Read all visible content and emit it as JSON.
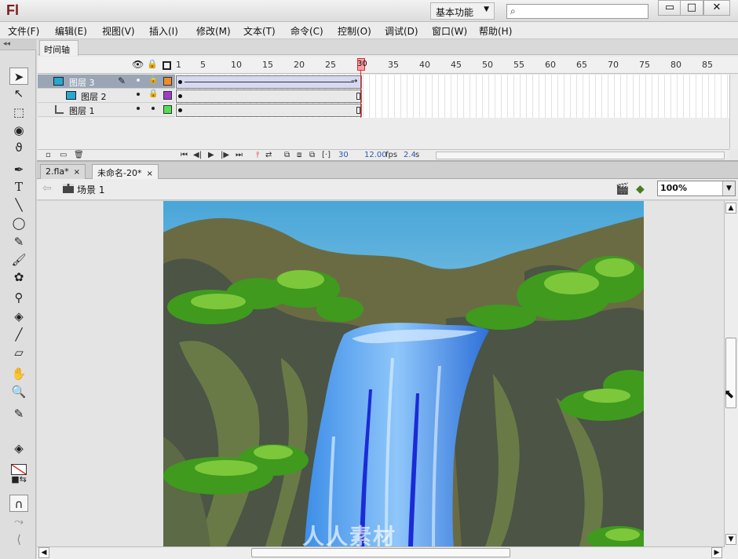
{
  "app": {
    "logo": "Fl",
    "workspace": "基本功能",
    "search_placeholder": "",
    "window_controls": {
      "minimize": "▭",
      "maximize": "□",
      "close": "✕"
    }
  },
  "menu": [
    "文件(F)",
    "编辑(E)",
    "视图(V)",
    "插入(I)",
    "修改(M)",
    "文本(T)",
    "命令(C)",
    "控制(O)",
    "调试(D)",
    "窗口(W)",
    "帮助(H)"
  ],
  "timeline": {
    "panel_title": "时间轴",
    "frame_numbers": [
      "1",
      "5",
      "10",
      "15",
      "20",
      "25",
      "30",
      "35",
      "40",
      "45",
      "50",
      "55",
      "60",
      "65",
      "70",
      "75",
      "80",
      "85"
    ],
    "current_frame": "30",
    "layers": [
      {
        "name": "图层 3",
        "color": "#f08c2a",
        "selected": true,
        "tween": true
      },
      {
        "name": "图层 2",
        "color": "#a03cc8",
        "selected": false,
        "tween": false
      },
      {
        "name": "图层 1",
        "color": "#50e050",
        "selected": false,
        "tween": false
      }
    ],
    "footer": {
      "frame": "30",
      "fps": "12.00",
      "fps_unit": "fps",
      "time": "2.4",
      "time_unit": "s"
    }
  },
  "documents": [
    {
      "title": "2.fla*",
      "close": "×",
      "active": false
    },
    {
      "title": "未命名-20*",
      "close": "×",
      "active": true
    }
  ],
  "editbar": {
    "scene": "场景 1",
    "zoom": "100%"
  },
  "watermark": "人人素材",
  "icons": {
    "tools": [
      "selection-arrow",
      "subselection-arrow",
      "free-transform",
      "3d-rotation",
      "lasso",
      "pen",
      "text",
      "line",
      "oval",
      "pencil",
      "brush",
      "deco",
      "bone",
      "paint-bucket",
      "eyedropper",
      "eraser",
      "hand",
      "zoom",
      "stroke-color",
      "fill-color",
      "swap-colors",
      "snap-magnet",
      "smooth",
      "straighten"
    ]
  },
  "colors": {
    "fill": "#ffff00",
    "stroke": "#e02020",
    "playhead": "#ff9ea8"
  }
}
